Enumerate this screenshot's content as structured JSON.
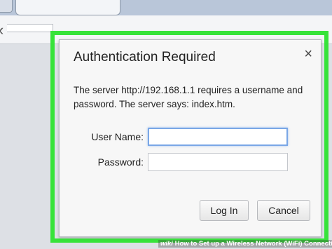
{
  "dialog": {
    "title": "Authentication Required",
    "close_icon": "close-icon",
    "close_glyph": "×",
    "message": "The server http://192.168.1.1 requires a username and password. The server says: index.htm.",
    "username_label": "User Name:",
    "username_value": "",
    "password_label": "Password:",
    "password_value": "",
    "login_label": "Log In",
    "cancel_label": "Cancel"
  },
  "highlight": {
    "color": "#37e33a"
  },
  "watermark": {
    "logo": "wiki",
    "text": "How to Set up a Wireless Network (WiFi) Connection"
  }
}
